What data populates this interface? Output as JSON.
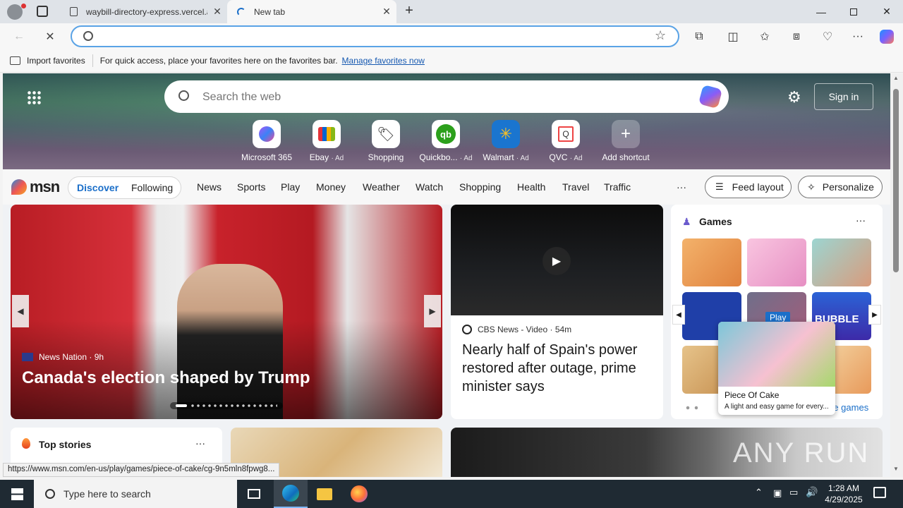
{
  "browser": {
    "tabs": [
      {
        "label": "waybill-directory-express.vercel.a"
      },
      {
        "label": "New tab"
      }
    ],
    "address_value": "",
    "favorites_bar": {
      "import_label": "Import favorites",
      "message": "For quick access, place your favorites here on the favorites bar.",
      "manage_link": "Manage favorites now"
    },
    "status_url": "https://www.msn.com/en-us/play/games/piece-of-cake/cg-9n5mln8fpwg8..."
  },
  "newtab": {
    "search_placeholder": "Search the web",
    "sign_in": "Sign in",
    "shortcuts": [
      {
        "label": "Microsoft 365",
        "ad": ""
      },
      {
        "label": "Ebay",
        "ad": "· Ad"
      },
      {
        "label": "Shopping",
        "ad": ""
      },
      {
        "label": "Quickbo...",
        "ad": "· Ad"
      },
      {
        "label": "Walmart",
        "ad": "· Ad"
      },
      {
        "label": "QVC",
        "ad": "· Ad"
      },
      {
        "label": "Add shortcut",
        "ad": ""
      }
    ],
    "logo": "msn",
    "feed_tabs": [
      "Discover",
      "Following"
    ],
    "nav": [
      "News",
      "Sports",
      "Play",
      "Money",
      "Weather",
      "Watch",
      "Shopping",
      "Health",
      "Travel",
      "Traffic"
    ],
    "more": "···",
    "feed_layout": "Feed layout",
    "personalize": "Personalize"
  },
  "main_story": {
    "source": "News Nation",
    "time": "· 9h",
    "headline": "Canada's election shaped by Trump"
  },
  "video_story": {
    "source": "CBS News - Video",
    "time": "· 54m",
    "headline": "Nearly half of Spain's power restored after outage, prime minister says"
  },
  "games": {
    "title": "Games",
    "play_label": "Play",
    "tile_text": "BUBBLE",
    "tooltip_title": "Piece Of Cake",
    "tooltip_desc": "A light and easy game for every...",
    "more_link": "re games"
  },
  "top_stories": {
    "title": "Top stories"
  },
  "watermark": "ANY RUN",
  "taskbar": {
    "search_placeholder": "Type here to search",
    "time": "1:28 AM",
    "date": "4/29/2025"
  }
}
